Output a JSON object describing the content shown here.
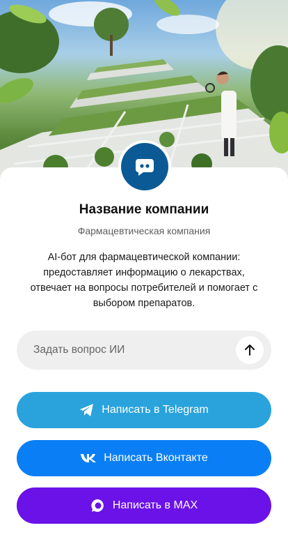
{
  "colors": {
    "avatar_bg": "#0b5a96",
    "telegram": "#2aa3dc",
    "vk": "#0a7ff5",
    "max": "#6a12e8",
    "input_bg": "#efefef"
  },
  "hero": {
    "image": "garden-laboratory-photo"
  },
  "avatar": {
    "icon": "chat-bot-icon"
  },
  "company": {
    "name": "Название компании",
    "subtitle": "Фармацевтическая компания",
    "description": "AI-бот для фармацевтической компании: предоставляет информацию о лекарствах, отвечает на вопросы потребителей и помогает с выбором препаратов."
  },
  "ask": {
    "placeholder": "Задать вопрос ИИ",
    "value": "",
    "send_icon": "arrow-up-icon"
  },
  "buttons": {
    "telegram": {
      "label": "Написать в Telegram",
      "icon": "telegram-icon"
    },
    "vk": {
      "label": "Написать Вконтакте",
      "icon": "vk-icon"
    },
    "max": {
      "label": "Написать в MAX",
      "icon": "max-icon"
    }
  }
}
